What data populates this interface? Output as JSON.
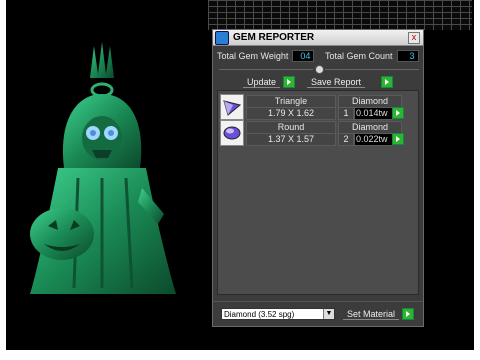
{
  "window": {
    "title": "GEM REPORTER",
    "close_glyph": "x"
  },
  "stats": {
    "weight_label": "Total Gem Weight",
    "weight_value": "04",
    "count_label": "Total Gem Count",
    "count_value": "3"
  },
  "buttons": {
    "update_label": "Update",
    "save_report_label": "Save Report",
    "set_material_label": "Set Material"
  },
  "gems": [
    {
      "shape": "Triangle",
      "dims": "1.79 X 1.62",
      "material": "Diamond",
      "qty": "1",
      "ctw": "0.014tw"
    },
    {
      "shape": "Round",
      "dims": "1.37 X 1.57",
      "material": "Diamond",
      "qty": "2",
      "ctw": "0.022tw"
    }
  ],
  "material_select": {
    "selected": "Diamond    (3.52 spg)"
  },
  "colors": {
    "model": "#1f8f5a",
    "eyes": "#8fd0ff",
    "value_text": "#3fc6e8",
    "go_button": "#2fb42f"
  }
}
